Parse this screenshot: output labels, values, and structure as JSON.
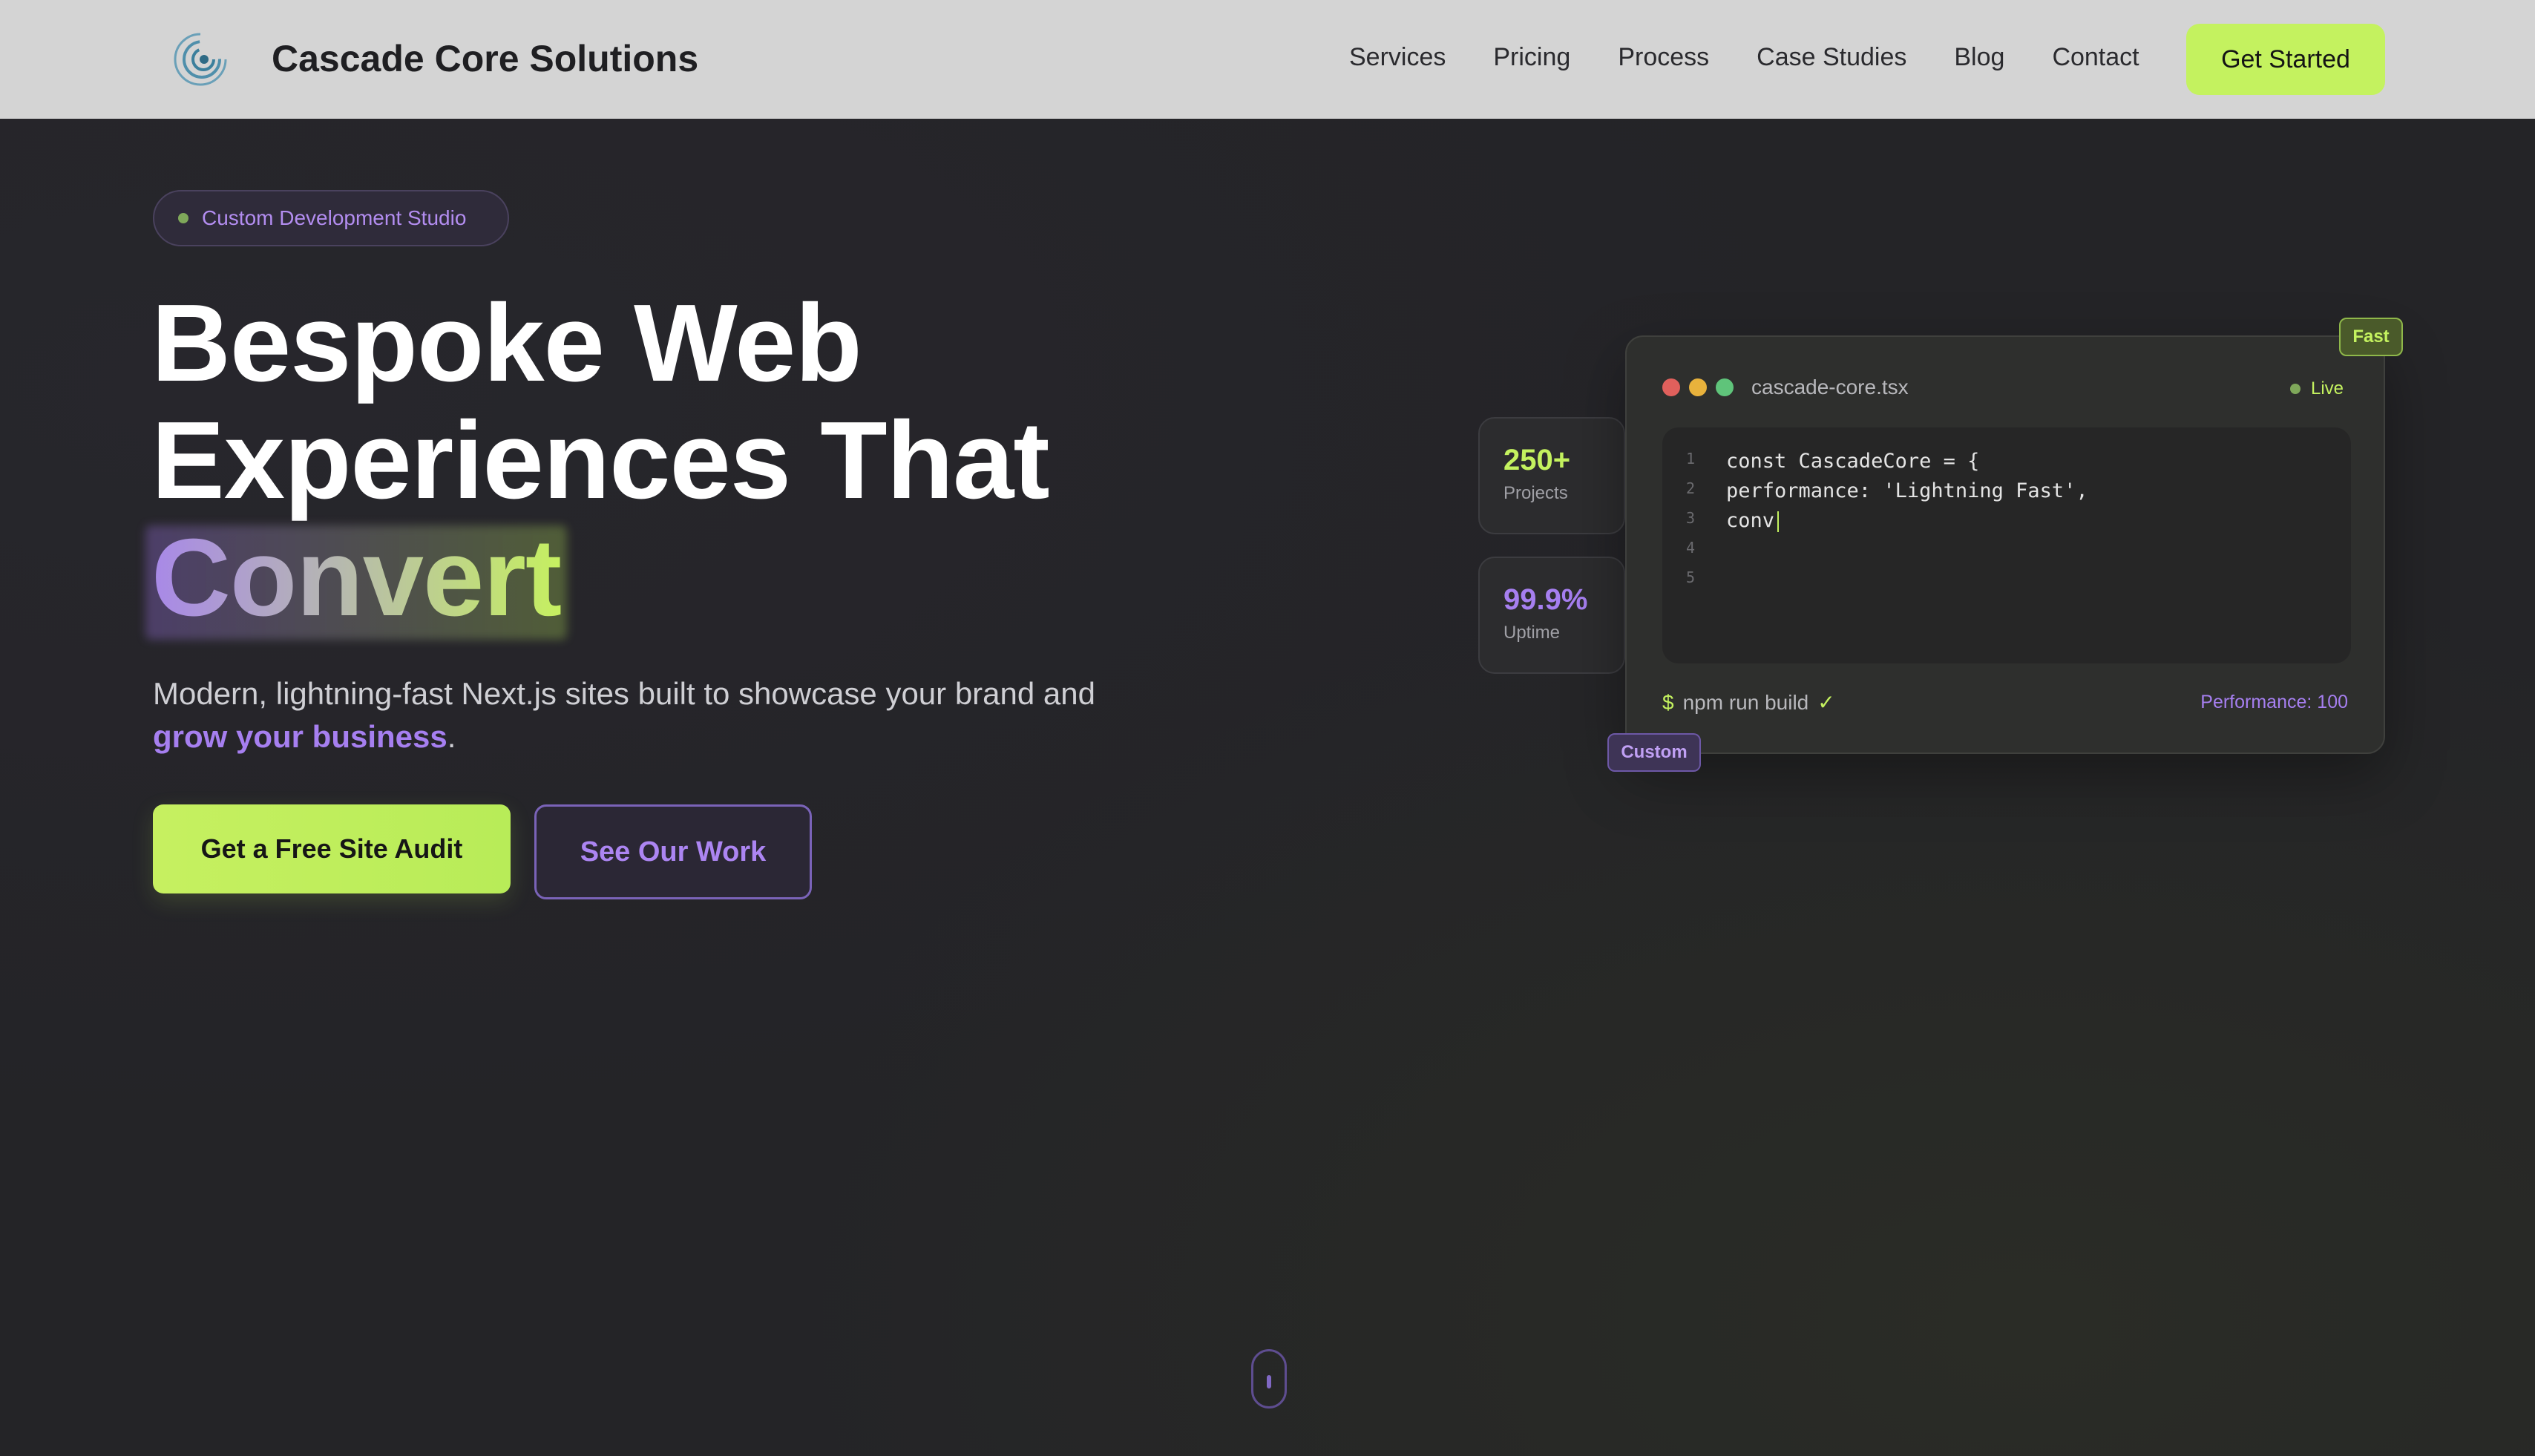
{
  "nav": {
    "brand": "Cascade Core Solutions",
    "links": [
      "Services",
      "Pricing",
      "Process",
      "Case Studies",
      "Blog",
      "Contact"
    ],
    "cta": "Get Started"
  },
  "hero": {
    "badge": "Custom Development Studio",
    "headline_line1": "Bespoke Web",
    "headline_line2": "Experiences That",
    "headline_highlight": "Convert",
    "subtitle_text": "Modern, lightning-fast Next.js sites built to showcase your brand and",
    "subtitle_accent": "grow your business",
    "subtitle_end": ".",
    "primary_cta": "Get a Free Site Audit",
    "secondary_cta": "See Our Work"
  },
  "stats": [
    {
      "value": "250+",
      "label": "Projects",
      "color": "#c4f25f"
    },
    {
      "value": "99.9%",
      "label": "Uptime",
      "color": "#a67ff0"
    }
  ],
  "editor": {
    "filename": "cascade-core.tsx",
    "status": "Live",
    "line_numbers": [
      "1",
      "2",
      "3",
      "4",
      "5"
    ],
    "code_lines": [
      "const CascadeCore = {",
      "performance: 'Lightning Fast',",
      "conv"
    ],
    "command_prompt": "$",
    "command": "npm run build",
    "command_check": "✓",
    "performance": "Performance: 100",
    "tag_fast": "Fast",
    "tag_custom": "Custom"
  },
  "colors": {
    "accent_lime": "#c4f25f",
    "accent_purple": "#a67ff0",
    "background": "#242427",
    "navbar": "#d4d4d4"
  },
  "icons": {
    "logo": "spiral-logo-icon",
    "scroll": "mouse-scroll-icon"
  }
}
